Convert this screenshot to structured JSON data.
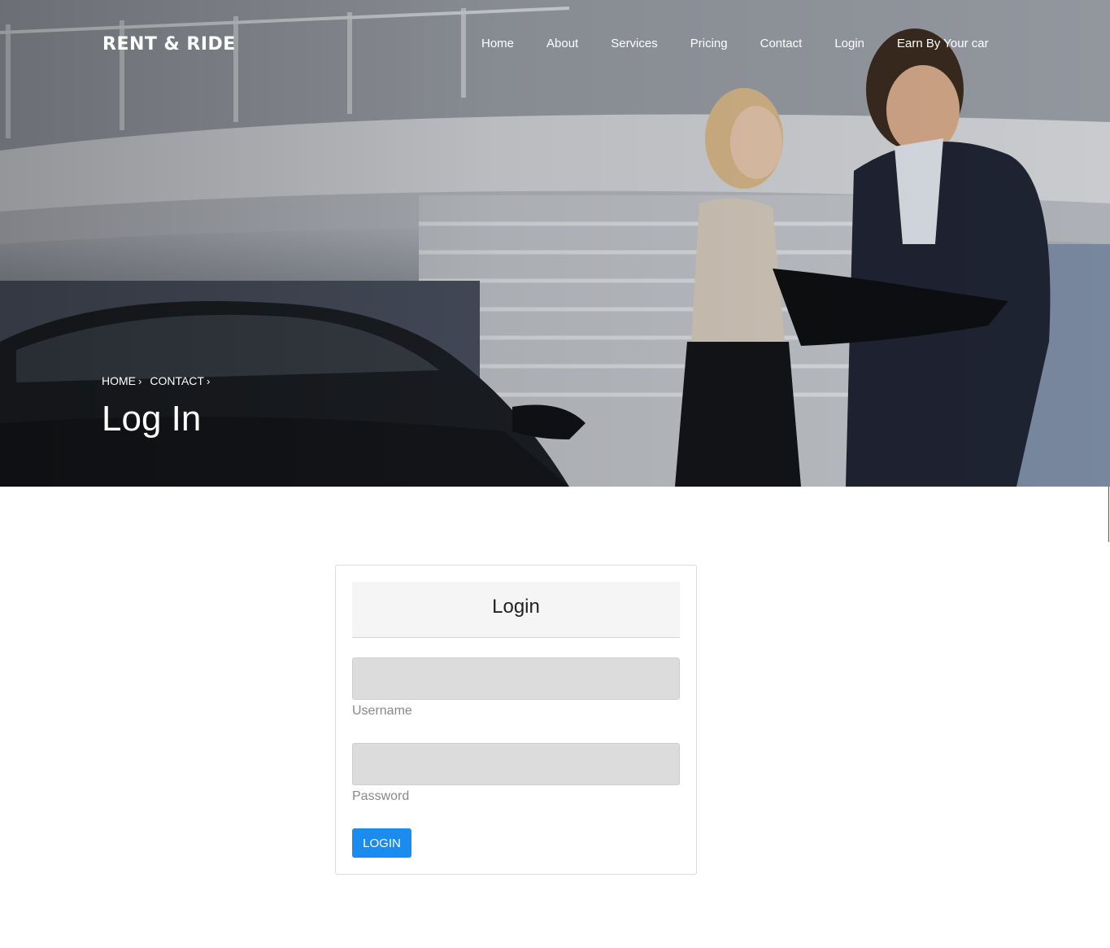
{
  "brand": "RENT &  RIDE",
  "nav": {
    "items": [
      {
        "label": "Home"
      },
      {
        "label": "About"
      },
      {
        "label": "Services"
      },
      {
        "label": "Pricing"
      },
      {
        "label": "Contact"
      },
      {
        "label": "Login"
      },
      {
        "label": "Earn By Your car"
      }
    ]
  },
  "breadcrumb": {
    "items": [
      {
        "label": "HOME",
        "separator": "›"
      },
      {
        "label": "CONTACT",
        "separator": "›"
      }
    ]
  },
  "hero": {
    "title": "Log In"
  },
  "login_form": {
    "title": "Login",
    "username": {
      "value": "",
      "label": "Username"
    },
    "password": {
      "value": "",
      "label": "Password"
    },
    "submit_label": "LOGIN"
  },
  "colors": {
    "button": "#1a8cf0",
    "input_bg": "#dcdcdc",
    "header_bg": "#f5f5f5"
  }
}
